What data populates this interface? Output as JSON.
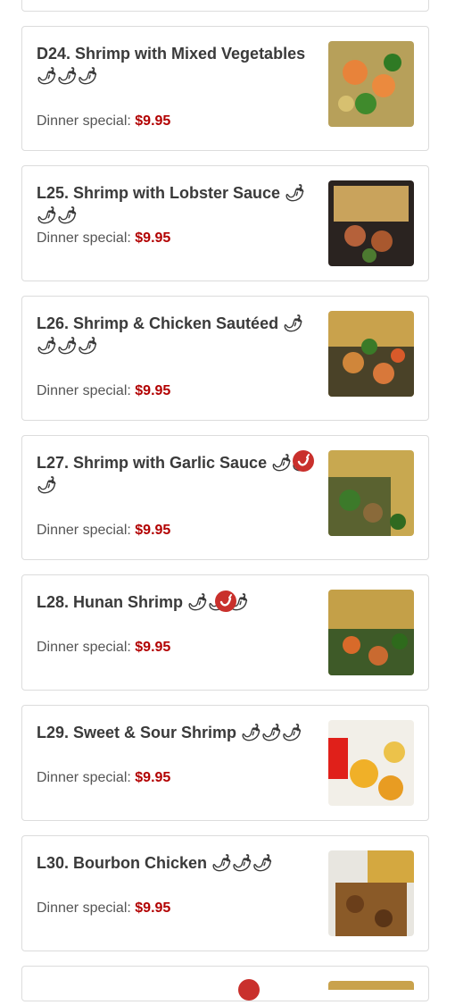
{
  "price_prefix": "Dinner special:",
  "items": [
    {
      "title": "D24. Shrimp with Mixed Vegetables 🌶🌶🌶",
      "price": "$9.95",
      "spicy": false
    },
    {
      "title": "L25. Shrimp with Lobster Sauce 🌶🌶🌶",
      "price": "$9.95",
      "spicy": false
    },
    {
      "title": "L26. Shrimp & Chicken Sautéed 🌶🌶🌶🌶",
      "price": "$9.95",
      "spicy": false
    },
    {
      "title": "L27. Shrimp with Garlic Sauce 🌶🌶🌶",
      "price": "$9.95",
      "spicy": true
    },
    {
      "title": "L28. Hunan Shrimp 🌶🌶🌶",
      "price": "$9.95",
      "spicy": true
    },
    {
      "title": "L29. Sweet & Sour Shrimp 🌶🌶🌶",
      "price": "$9.95",
      "spicy": false
    },
    {
      "title": "L30. Bourbon Chicken 🌶🌶🌶",
      "price": "$9.95",
      "spicy": false
    }
  ],
  "colors": {
    "price": "#b20000",
    "chili": "#c9302c"
  },
  "icons": {
    "spicy": "chili-pepper-icon"
  }
}
